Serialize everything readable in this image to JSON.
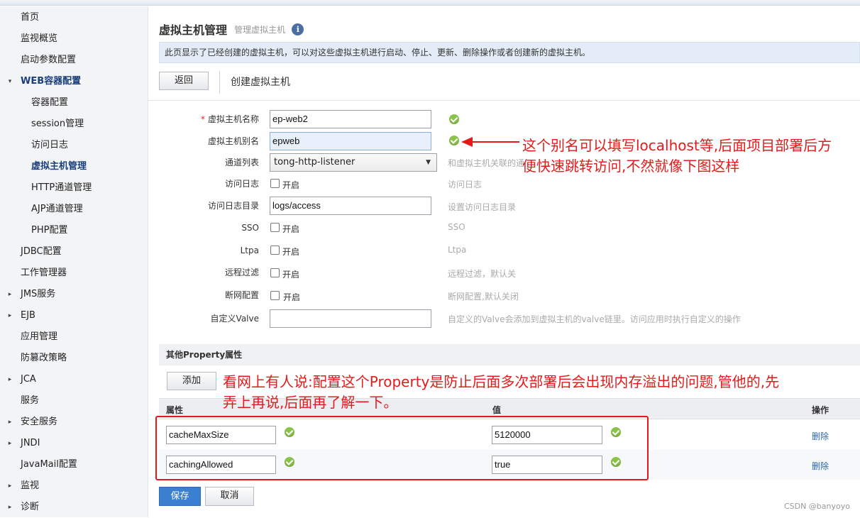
{
  "sidebar": {
    "items": [
      {
        "label": "首页",
        "level": 0,
        "arrow": ""
      },
      {
        "label": "监视概览",
        "level": 0,
        "arrow": ""
      },
      {
        "label": "启动参数配置",
        "level": 0,
        "arrow": ""
      },
      {
        "label": "WEB容器配置",
        "level": 0,
        "arrow": "▾",
        "bold": true
      },
      {
        "label": "容器配置",
        "level": 1,
        "arrow": ""
      },
      {
        "label": "session管理",
        "level": 1,
        "arrow": ""
      },
      {
        "label": "访问日志",
        "level": 1,
        "arrow": ""
      },
      {
        "label": "虚拟主机管理",
        "level": 1,
        "arrow": "",
        "bold": true
      },
      {
        "label": "HTTP通道管理",
        "level": 1,
        "arrow": ""
      },
      {
        "label": "AJP通道管理",
        "level": 1,
        "arrow": ""
      },
      {
        "label": "PHP配置",
        "level": 1,
        "arrow": ""
      },
      {
        "label": "JDBC配置",
        "level": 0,
        "arrow": ""
      },
      {
        "label": "工作管理器",
        "level": 0,
        "arrow": ""
      },
      {
        "label": "JMS服务",
        "level": 0,
        "arrow": "▸"
      },
      {
        "label": "EJB",
        "level": 0,
        "arrow": "▸"
      },
      {
        "label": "应用管理",
        "level": 0,
        "arrow": ""
      },
      {
        "label": "防篡改策略",
        "level": 0,
        "arrow": ""
      },
      {
        "label": "JCA",
        "level": 0,
        "arrow": "▸"
      },
      {
        "label": "服务",
        "level": 0,
        "arrow": ""
      },
      {
        "label": "安全服务",
        "level": 0,
        "arrow": "▸"
      },
      {
        "label": "JNDI",
        "level": 0,
        "arrow": "▸"
      },
      {
        "label": "JavaMail配置",
        "level": 0,
        "arrow": ""
      },
      {
        "label": "监视",
        "level": 0,
        "arrow": "▸"
      },
      {
        "label": "诊断",
        "level": 0,
        "arrow": "▸"
      }
    ]
  },
  "header": {
    "title": "虚拟主机管理",
    "subtitle": "管理虚拟主机",
    "info_icon": "i",
    "description": "此页显示了已经创建的虚拟主机，可以对这些虚拟主机进行启动、停止、更新、删除操作或者创建新的虚拟主机。"
  },
  "toolbar": {
    "back_label": "返回",
    "create_title": "创建虚拟主机"
  },
  "form": {
    "required_mark": "*",
    "name_label": "虚拟主机名称",
    "name_value": "ep-web2",
    "alias_label": "虚拟主机别名",
    "alias_value": "epweb",
    "channel_label": "通道列表",
    "channel_value": "tong-http-listener",
    "channel_hint": "和虚拟主机关联的通",
    "accesslog_label": "访问日志",
    "accesslog_hint": "访问日志",
    "logdir_label": "访问日志目录",
    "logdir_value": "logs/access",
    "logdir_hint": "设置访问日志目录",
    "sso_label": "SSO",
    "sso_hint": "SSO",
    "ltpa_label": "Ltpa",
    "ltpa_hint": "Ltpa",
    "remote_label": "远程过滤",
    "remote_hint": "远程过滤，默认关",
    "disconnect_label": "断网配置",
    "disconnect_hint": "断网配置,默认关闭",
    "valve_label": "自定义Valve",
    "valve_value": "",
    "valve_hint": "自定义的Valve会添加到虚拟主机的valve链里。访问应用时执行自定义的操作",
    "enable_label": "开启"
  },
  "properties": {
    "section_title": "其他Property属性",
    "add_label": "添加",
    "col_property": "属性",
    "col_value": "值",
    "col_action": "操作",
    "rows": [
      {
        "property": "cacheMaxSize",
        "value": "5120000",
        "action": "删除"
      },
      {
        "property": "cachingAllowed",
        "value": "true",
        "action": "删除"
      }
    ]
  },
  "footer": {
    "save_label": "保存",
    "cancel_label": "取消",
    "watermark": "CSDN @banyoyo"
  },
  "annotations": {
    "alias_note_line1": "这个别名可以填写localhost等,后面项目部署后方",
    "alias_note_line2": "便快速跳转访问,不然就像下图这样",
    "property_note_line1": "看网上有人说:配置这个Property是防止后面多次部署后会出现内存溢出的问题,管他的,先",
    "property_note_line2": "弄上再说,后面再了解一下。",
    "color": "#e51a1a"
  }
}
